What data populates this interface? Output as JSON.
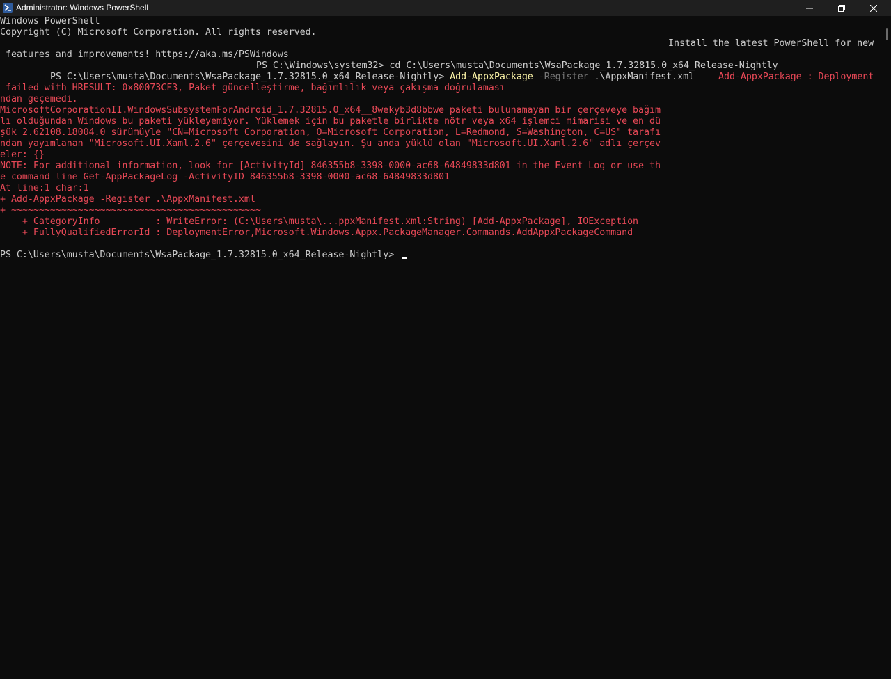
{
  "window": {
    "title": "Administrator: Windows PowerShell",
    "icon": "powershell-icon",
    "controls": [
      "minimize-icon",
      "maximize-icon",
      "close-icon"
    ]
  },
  "console": {
    "lines": [
      "Windows PowerShell",
      "Copyright (C) Microsoft Corporation. All rights reserved.",
      "Install the latest PowerShell for new",
      "features and improvements! https://aka.ms/PSWindows",
      "PS C:\\Windows\\system32> cd C:\\Users\\musta\\Documents\\WsaPackage_1.7.32815.0_x64_Release-Nightly"
    ],
    "cmd_prompt": "PS C:\\Users\\musta\\Documents\\WsaPackage_1.7.32815.0_x64_Release-Nightly> ",
    "cmd_name": "Add-AppxPackage",
    "cmd_param": " -Register",
    "cmd_arg": " .\\AppxManifest.xml",
    "cmd_error_start": "Add-AppxPackage : Deployment",
    "errors": [
      " failed with HRESULT: 0x80073CF3, Paket güncelleştirme, bağımlılık veya çakışma doğrulaması",
      "ndan geçemedi.",
      "MicrosoftCorporationII.WindowsSubsystemForAndroid_1.7.32815.0_x64__8wekyb3d8bbwe paketi bulunamayan bir çerçeveye bağım",
      "lı olduğundan Windows bu paketi yükleyemiyor. Yüklemek için bu paketle birlikte nötr veya x64 işlemci mimarisi ve en dü",
      "şük 2.62108.18004.0 sürümüyle \"CN=Microsoft Corporation, O=Microsoft Corporation, L=Redmond, S=Washington, C=US\" tarafı",
      "ndan yayımlanan \"Microsoft.UI.Xaml.2.6\" çerçevesini de sağlayın. Şu anda yüklü olan \"Microsoft.UI.Xaml.2.6\" adlı çerçev",
      "eler: {}",
      "NOTE: For additional information, look for [ActivityId] 846355b8-3398-0000-ac68-64849833d801 in the Event Log or use th",
      "e command line Get-AppPackageLog -ActivityID 846355b8-3398-0000-ac68-64849833d801",
      "At line:1 char:1",
      "+ Add-AppxPackage -Register .\\AppxManifest.xml",
      "+ ~~~~~~~~~~~~~~~~~~~~~~~~~~~~~~~~~~~~~~~~~~~~~",
      "    + CategoryInfo          : WriteError: (C:\\Users\\musta\\...ppxManifest.xml:String) [Add-AppxPackage], IOException",
      "    + FullyQualifiedErrorId : DeploymentError,Microsoft.Windows.Appx.PackageManager.Commands.AddAppxPackageCommand"
    ],
    "final_prompt": "PS C:\\Users\\musta\\Documents\\WsaPackage_1.7.32815.0_x64_Release-Nightly> "
  },
  "colors": {
    "background": "#0c0c0c",
    "foreground": "#cccccc",
    "error": "#e74856",
    "command": "#f9f1a5",
    "parameter": "#767676",
    "titlebar": "#1f1f1f"
  }
}
